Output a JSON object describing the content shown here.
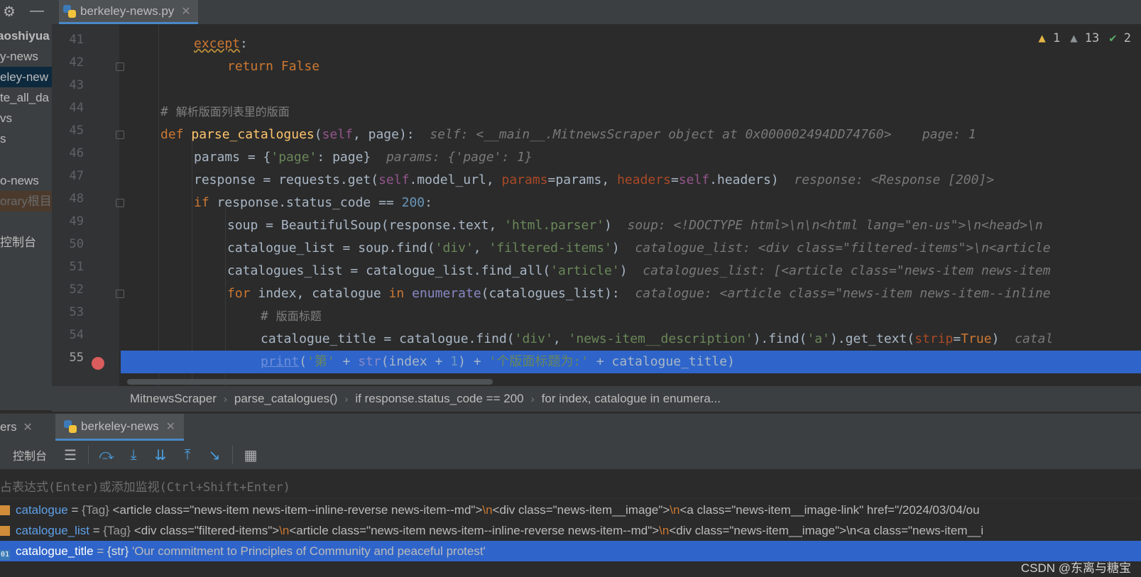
{
  "project": {
    "items": [
      "aoshiyua",
      "y-news",
      "eley-new",
      "te_all_da",
      "vs",
      "s",
      "o-news",
      "orary根目",
      "控制台"
    ]
  },
  "editor_tab": {
    "filename": "berkeley-news.py"
  },
  "inspection": {
    "warnings": "1",
    "weak_warnings": "13",
    "ok": "2"
  },
  "code": {
    "line_numbers": [
      "41",
      "42",
      "43",
      "44",
      "45",
      "46",
      "47",
      "48",
      "49",
      "50",
      "51",
      "52",
      "53",
      "54",
      "55"
    ],
    "lines": {
      "l41_kw": "except",
      "l41_colon": ":",
      "l42_kw": "return",
      "l42_val": "False",
      "l44_hash": "# ",
      "l44_text": "解析版面列表里的版面",
      "l45_def": "def",
      "l45_fn": "parse_catalogues",
      "l45_open": "(",
      "l45_self": "self",
      "l45_rest": ", page):",
      "l45_hint": "self: <__main__.MitnewsScraper object at 0x000002494DD74760>    page: 1",
      "l46_code_a": "params = {",
      "l46_str": "'page'",
      "l46_code_b": ": page}",
      "l46_hint": "params: {'page': 1}",
      "l47_code_a": "response = requests.get(",
      "l47_self1": "self",
      "l47_code_b": ".model_url, ",
      "l47_p1": "params",
      "l47_code_c": "=params, ",
      "l47_p2": "headers",
      "l47_code_d": "=",
      "l47_self2": "self",
      "l47_code_e": ".headers)",
      "l47_hint": "response: <Response [200]>",
      "l48_kw": "if",
      "l48_code": " response.status_code == ",
      "l48_num": "200",
      "l48_colon": ":",
      "l49_code_a": "soup = BeautifulSoup(response.text, ",
      "l49_str": "'html.parser'",
      "l49_code_b": ")",
      "l49_hint": "soup: <!DOCTYPE html>\\n\\n<html lang=\"en-us\">\\n<head>\\n",
      "l50_code_a": "catalogue_list = soup.find(",
      "l50_str1": "'div'",
      "l50_comma": ", ",
      "l50_str2": "'filtered-items'",
      "l50_code_b": ")",
      "l50_hint": "catalogue_list: <div class=\"filtered-items\">\\n<article",
      "l51_code_a": "catalogues_list = catalogue_list.find_all(",
      "l51_str": "'article'",
      "l51_code_b": ")",
      "l51_hint": "catalogues_list: [<article class=\"news-item news-item",
      "l52_kw1": "for",
      "l52_code_a": " index, catalogue ",
      "l52_kw2": "in",
      "l52_sp": " ",
      "l52_bi": "enumerate",
      "l52_code_b": "(catalogues_list):",
      "l52_hint": "catalogue: <article class=\"news-item news-item--inline",
      "l53_hash": "# ",
      "l53_text": "版面标题",
      "l54_code_a": "catalogue_title = catalogue.find(",
      "l54_str1": "'div'",
      "l54_comma": ", ",
      "l54_str2": "'news-item__description'",
      "l54_code_b": ").find(",
      "l54_str3": "'a'",
      "l54_code_c": ").get_text(",
      "l54_prm": "strip",
      "l54_eq": "=",
      "l54_kwv": "True",
      "l54_code_d": ")",
      "l54_hint": "catal",
      "l55_print": "print",
      "l55_open": "(",
      "l55_str1": "'第'",
      "l55_plus1": " + ",
      "l55_str": "str",
      "l55_code_a": "(index + ",
      "l55_num": "1",
      "l55_code_b": ") + ",
      "l55_str2": "'个版面标题为:'",
      "l55_code_c": " + catalogue_title)"
    }
  },
  "breadcrumb": [
    "MitnewsScraper",
    "parse_catalogues()",
    "if response.status_code == 200",
    "for index, catalogue in enumera..."
  ],
  "debug": {
    "tab_prev": "ers",
    "tab_active": "berkeley-news",
    "console_label": "控制台",
    "eval_placeholder": "占表达式(Enter)或添加监视(Ctrl+Shift+Enter)",
    "variables": [
      {
        "name": "catalogue",
        "eq": " = ",
        "type": "{Tag}",
        "v1": " <article class=\"news-item news-item--inline-reverse news-item--md\">",
        "e1": "\\n",
        "v2": "<div class=\"news-item__image\">",
        "e2": "\\n",
        "v3": "<a class=\"news-item__image-link\" href=\"/2024/03/04/ou"
      },
      {
        "name": "catalogue_list",
        "eq": " = ",
        "type": "{Tag}",
        "v1": " <div class=\"filtered-items\">",
        "e1": "\\n",
        "v2": "<article class=\"news-item news-item--inline-reverse news-item--md\">",
        "e2": "\\n",
        "v3": "<div class=\"news-item__image\">\\n<a class=\"news-item__i"
      },
      {
        "name": "catalogue_title",
        "eq": " = ",
        "type": "{str}",
        "v1": " 'Our commitment to Principles of Community and peaceful protest'",
        "icon_text": "01"
      }
    ]
  },
  "watermark": "CSDN @东离与糖宝"
}
